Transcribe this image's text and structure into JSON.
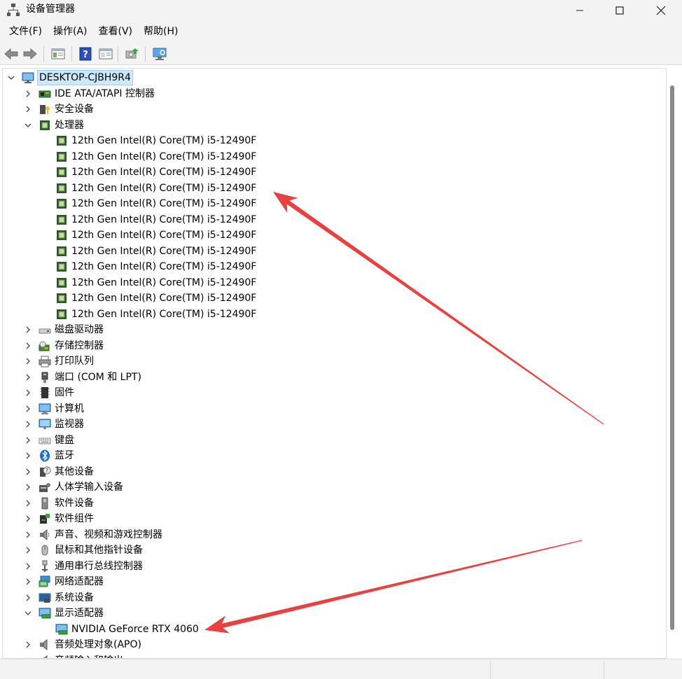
{
  "window": {
    "title": "设备管理器"
  },
  "menu": [
    {
      "label": "文件(F)"
    },
    {
      "label": "操作(A)"
    },
    {
      "label": "查看(V)"
    },
    {
      "label": "帮助(H)"
    }
  ],
  "tree": {
    "root": "DESKTOP-CJBH9R4",
    "categories": [
      {
        "label": "IDE ATA/ATAPI 控制器",
        "icon": "ide-controller-icon"
      },
      {
        "label": "安全设备",
        "icon": "security-device-icon"
      },
      {
        "label": "处理器",
        "icon": "processor-icon",
        "expanded": true,
        "children": [
          "12th Gen Intel(R) Core(TM) i5-12490F",
          "12th Gen Intel(R) Core(TM) i5-12490F",
          "12th Gen Intel(R) Core(TM) i5-12490F",
          "12th Gen Intel(R) Core(TM) i5-12490F",
          "12th Gen Intel(R) Core(TM) i5-12490F",
          "12th Gen Intel(R) Core(TM) i5-12490F",
          "12th Gen Intel(R) Core(TM) i5-12490F",
          "12th Gen Intel(R) Core(TM) i5-12490F",
          "12th Gen Intel(R) Core(TM) i5-12490F",
          "12th Gen Intel(R) Core(TM) i5-12490F",
          "12th Gen Intel(R) Core(TM) i5-12490F",
          "12th Gen Intel(R) Core(TM) i5-12490F"
        ]
      },
      {
        "label": "磁盘驱动器",
        "icon": "disk-drive-icon"
      },
      {
        "label": "存储控制器",
        "icon": "storage-controller-icon"
      },
      {
        "label": "打印队列",
        "icon": "printer-icon"
      },
      {
        "label": "端口 (COM 和 LPT)",
        "icon": "port-icon"
      },
      {
        "label": "固件",
        "icon": "firmware-icon"
      },
      {
        "label": "计算机",
        "icon": "computer-icon"
      },
      {
        "label": "监视器",
        "icon": "monitor-icon"
      },
      {
        "label": "键盘",
        "icon": "keyboard-icon"
      },
      {
        "label": "蓝牙",
        "icon": "bluetooth-icon"
      },
      {
        "label": "其他设备",
        "icon": "unknown-device-icon"
      },
      {
        "label": "人体学输入设备",
        "icon": "hid-icon"
      },
      {
        "label": "软件设备",
        "icon": "software-device-icon"
      },
      {
        "label": "软件组件",
        "icon": "software-component-icon"
      },
      {
        "label": "声音、视频和游戏控制器",
        "icon": "speaker-icon"
      },
      {
        "label": "鼠标和其他指针设备",
        "icon": "mouse-icon"
      },
      {
        "label": "通用串行总线控制器",
        "icon": "usb-icon"
      },
      {
        "label": "网络适配器",
        "icon": "network-adapter-icon"
      },
      {
        "label": "系统设备",
        "icon": "system-device-icon"
      },
      {
        "label": "显示适配器",
        "icon": "display-adapter-icon",
        "expanded": true,
        "children": [
          "NVIDIA GeForce RTX 4060"
        ]
      },
      {
        "label": "音频处理对象(APO)",
        "icon": "audio-processing-icon"
      },
      {
        "label": "音频输入和输出",
        "icon": "audio-io-icon"
      }
    ]
  },
  "colors": {
    "selection_bg": "#cce8ff",
    "annotation_arrow": "#e8413f",
    "chrome_bg": "#f3f3f3"
  }
}
